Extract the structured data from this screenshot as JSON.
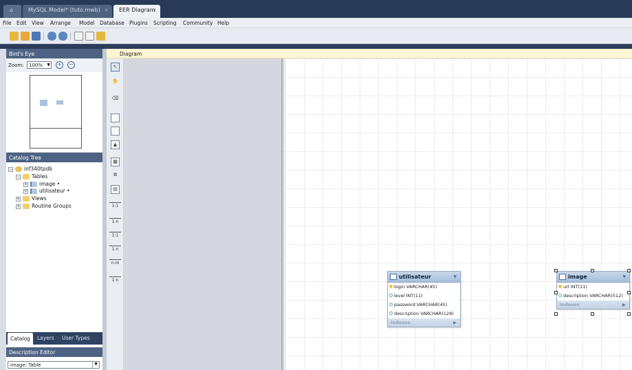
{
  "tabs": {
    "home_tooltip": "Home",
    "model_tab": "MySQL Model* (tuto.mwb)",
    "eer_tab": "EER Diagram",
    "close_glyph": "×"
  },
  "menu": [
    "File",
    "Edit",
    "View",
    "Arrange",
    "Model",
    "Database",
    "Plugins",
    "Scripting",
    "Community",
    "Help"
  ],
  "birds_eye": {
    "title": "Bird's Eye",
    "zoom_label": "Zoom:",
    "zoom_value": "100%"
  },
  "catalog_tree": {
    "title": "Catalog Tree",
    "schema": "inf340tpdb",
    "tables_label": "Tables",
    "tables": [
      "image •",
      "utilisateur •"
    ],
    "views_label": "Views",
    "routines_label": "Routine Groups"
  },
  "bottom_tabs": [
    "Catalog",
    "Layers",
    "User Types"
  ],
  "description_editor": {
    "title": "Description Editor",
    "selected": "image: Table"
  },
  "diagram": {
    "header": "Diagram",
    "rel_labels": [
      "1:1",
      "1:n",
      "1:1",
      "1:n",
      "n:m",
      "1:n"
    ],
    "tables": [
      {
        "name": "utilisateur",
        "columns": [
          {
            "text": "login VARCHAR(45)",
            "kind": "pk"
          },
          {
            "text": "level INT(11)",
            "kind": "attr"
          },
          {
            "text": "password VARCHAR(45)",
            "kind": "attr"
          },
          {
            "text": "description VARCHAR(128)",
            "kind": "attr"
          }
        ],
        "indexes_label": "Indexes"
      },
      {
        "name": "image",
        "columns": [
          {
            "text": "url INT(11)",
            "kind": "pk"
          },
          {
            "text": "description VARCHAR(512)",
            "kind": "attr"
          }
        ],
        "indexes_label": "Indexes"
      }
    ]
  },
  "colors": {
    "tabbar": "#283a58",
    "panel_header": "#4e6384",
    "diagram_header": "#fdf4d3",
    "table_header": "#a6bedc",
    "pk_key": "#e8c33c"
  }
}
